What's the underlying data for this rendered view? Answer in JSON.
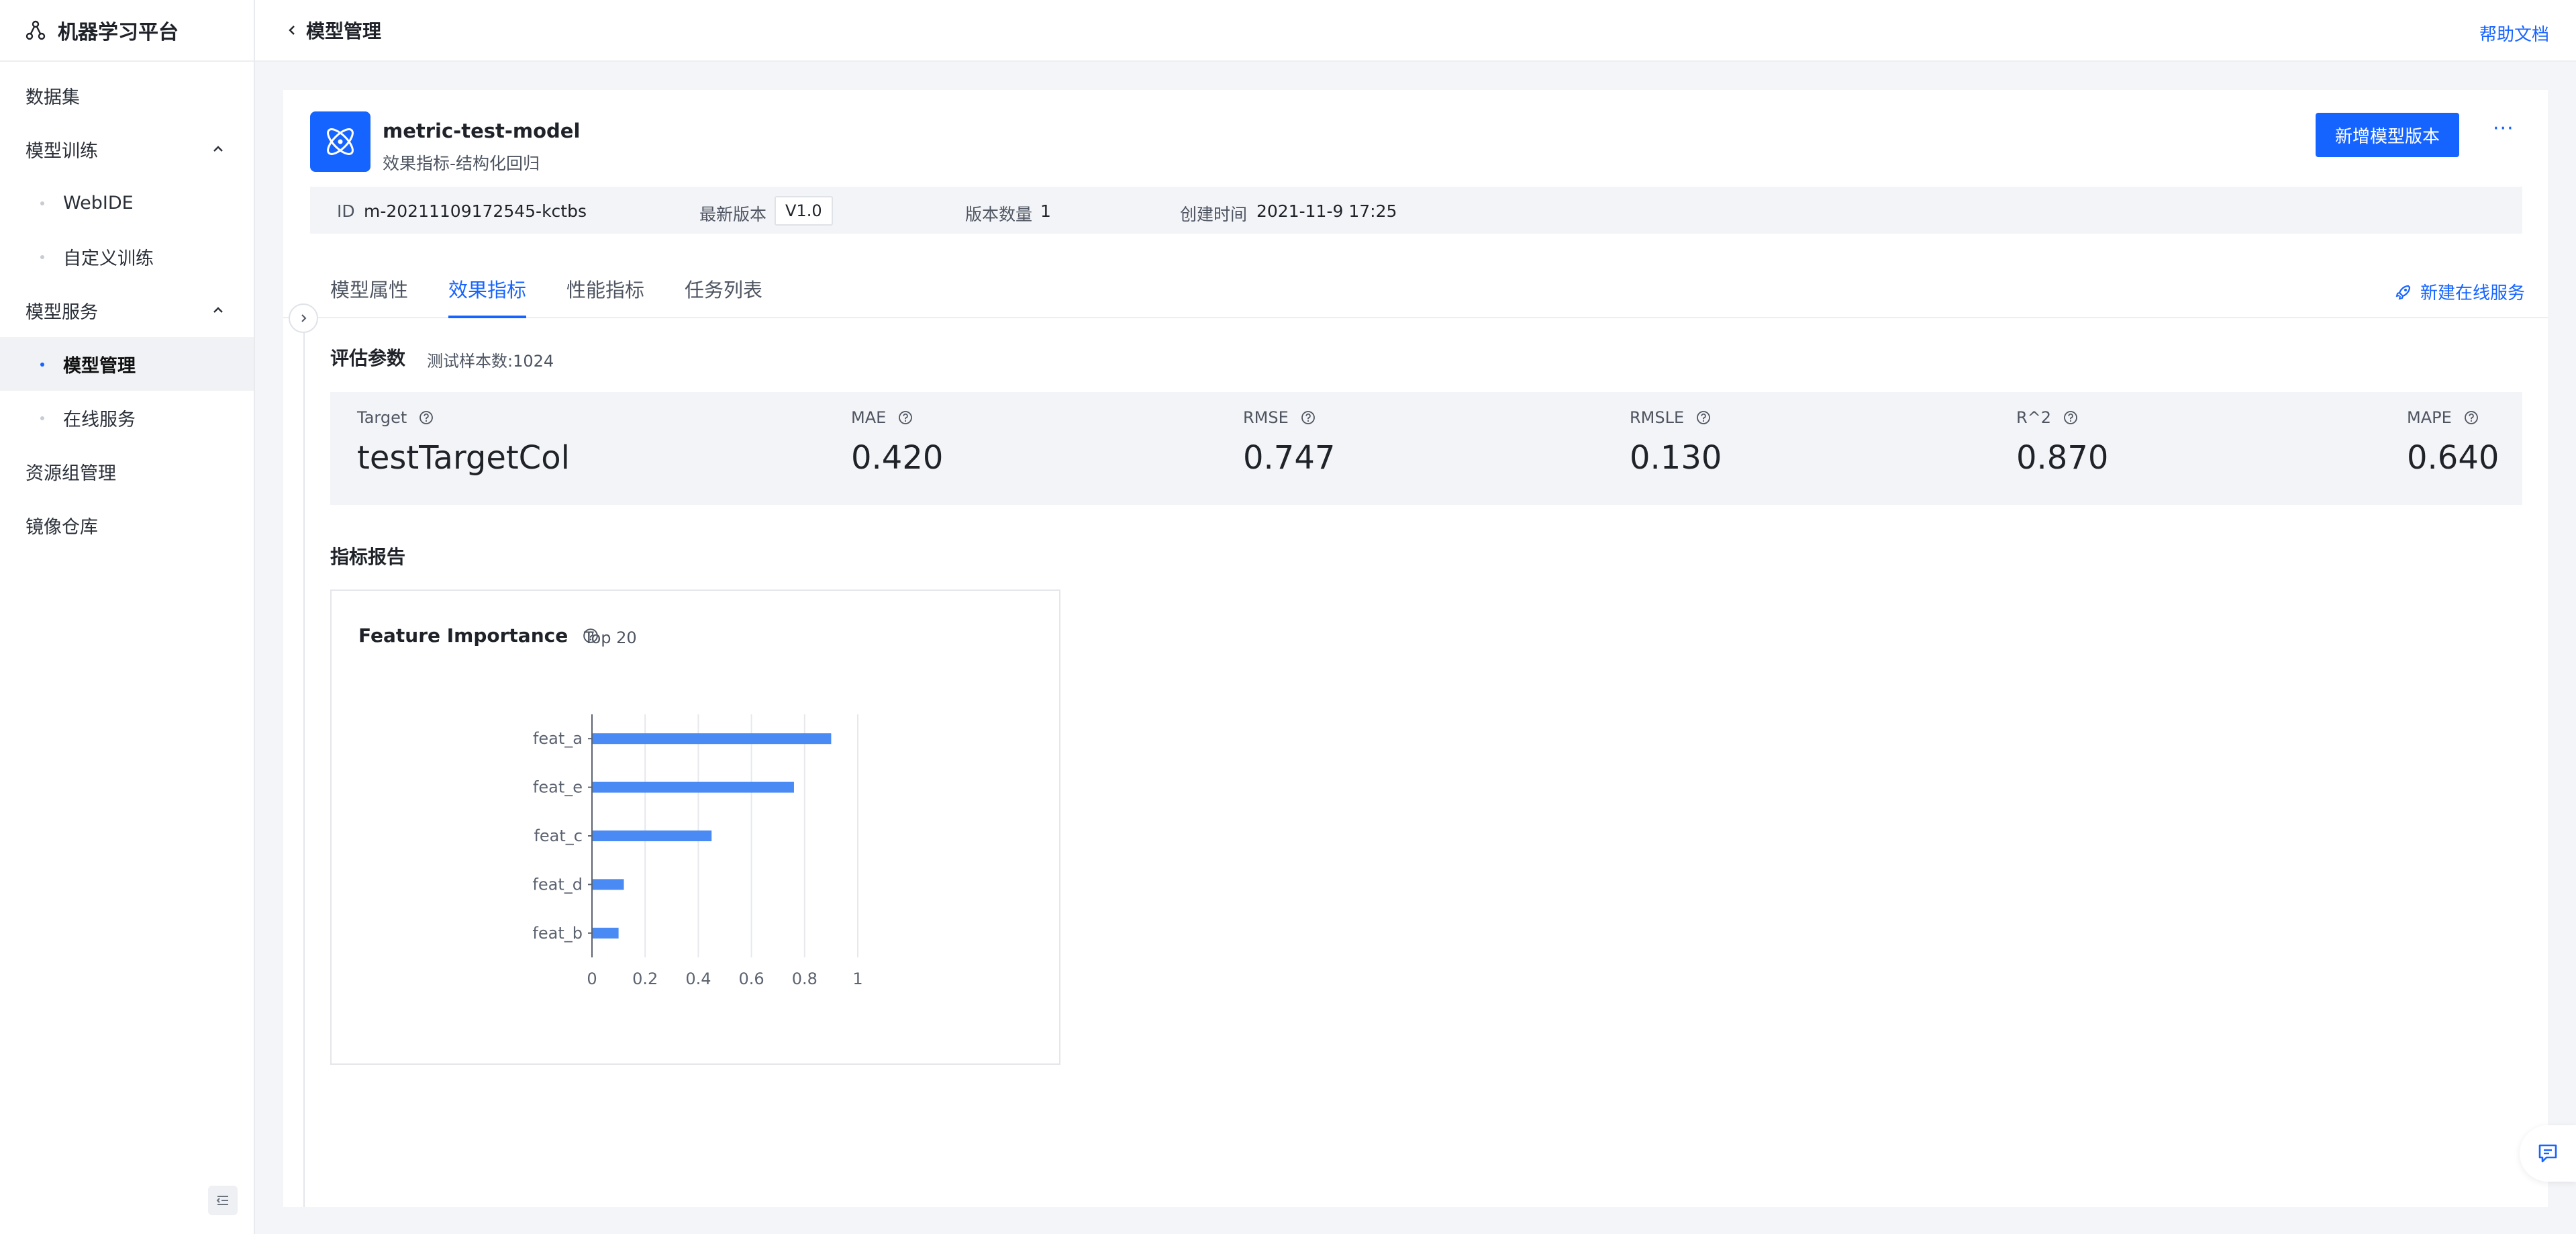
{
  "brand": {
    "title": "机器学习平台"
  },
  "sidebar": {
    "items": [
      {
        "label": "数据集"
      },
      {
        "label": "模型训练",
        "children": [
          "WebIDE",
          "自定义训练"
        ]
      },
      {
        "label": "模型服务",
        "children": [
          "模型管理",
          "在线服务"
        ],
        "active_child": "模型管理"
      },
      {
        "label": "资源组管理"
      },
      {
        "label": "镜像仓库"
      }
    ]
  },
  "topbar": {
    "title": "模型管理",
    "help": "帮助文档"
  },
  "model": {
    "name": "metric-test-model",
    "subtitle": "效果指标-结构化回归",
    "add_version": "新增模型版本",
    "more": "···",
    "meta": {
      "id_label": "ID",
      "id_value": "m-20211109172545-kctbs",
      "latest_label": "最新版本",
      "latest_value": "V1.0",
      "count_label": "版本数量",
      "count_value": "1",
      "created_label": "创建时间",
      "created_value": "2021-11-9 17:25"
    }
  },
  "tabs": [
    "模型属性",
    "效果指标",
    "性能指标",
    "任务列表"
  ],
  "active_tab": "效果指标",
  "new_service": "新建在线服务",
  "eval": {
    "title": "评估参数",
    "sample_count": "测试样本数:1024",
    "metrics": [
      {
        "label": "Target",
        "value": "testTargetCol"
      },
      {
        "label": "MAE",
        "value": "0.420"
      },
      {
        "label": "RMSE",
        "value": "0.747"
      },
      {
        "label": "RMSLE",
        "value": "0.130"
      },
      {
        "label": "R^2",
        "value": "0.870"
      },
      {
        "label": "MAPE",
        "value": "0.640"
      }
    ]
  },
  "report": {
    "title": "指标报告",
    "chart_title": "Feature Importance",
    "top": "Top 20"
  },
  "chart_data": {
    "type": "bar",
    "orientation": "horizontal",
    "title": "Feature Importance",
    "categories": [
      "feat_a",
      "feat_e",
      "feat_c",
      "feat_d",
      "feat_b"
    ],
    "values": [
      0.9,
      0.76,
      0.45,
      0.12,
      0.1
    ],
    "xlim": [
      0,
      1
    ],
    "xticks": [
      0,
      0.2,
      0.4,
      0.6,
      0.8,
      1
    ],
    "grid": true,
    "bar_color": "#4a8af4"
  },
  "colors": {
    "accent": "#1664ff"
  }
}
